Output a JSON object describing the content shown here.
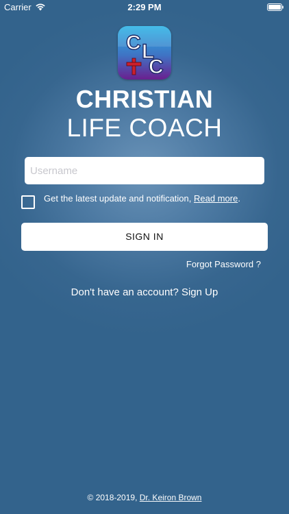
{
  "status_bar": {
    "carrier": "Carrier",
    "time": "2:29 PM",
    "wifi_icon": "wifi-icon",
    "battery_icon": "battery-full-icon"
  },
  "logo": {
    "letters": [
      "C",
      "L",
      "C"
    ],
    "cross_icon": "cross-icon",
    "cross_color": "#cc1f2d",
    "gradient_top": "#2bb3e6",
    "gradient_bottom": "#6a1f8f"
  },
  "brand": {
    "title": "CHRISTIAN",
    "subtitle": "LIFE COACH"
  },
  "login": {
    "username_placeholder": "Username",
    "username_value": "",
    "consent_checked": false,
    "consent_text": "Get the latest update and notification,",
    "read_more_label": "Read more",
    "consent_suffix": ".",
    "sign_in_label": "SIGN IN",
    "forgot_label": "Forgot Password ?",
    "signup_label": "Don't have an account? Sign Up"
  },
  "footer": {
    "copyright": "© 2018-2019,",
    "author_label": "Dr. Keiron Brown"
  }
}
